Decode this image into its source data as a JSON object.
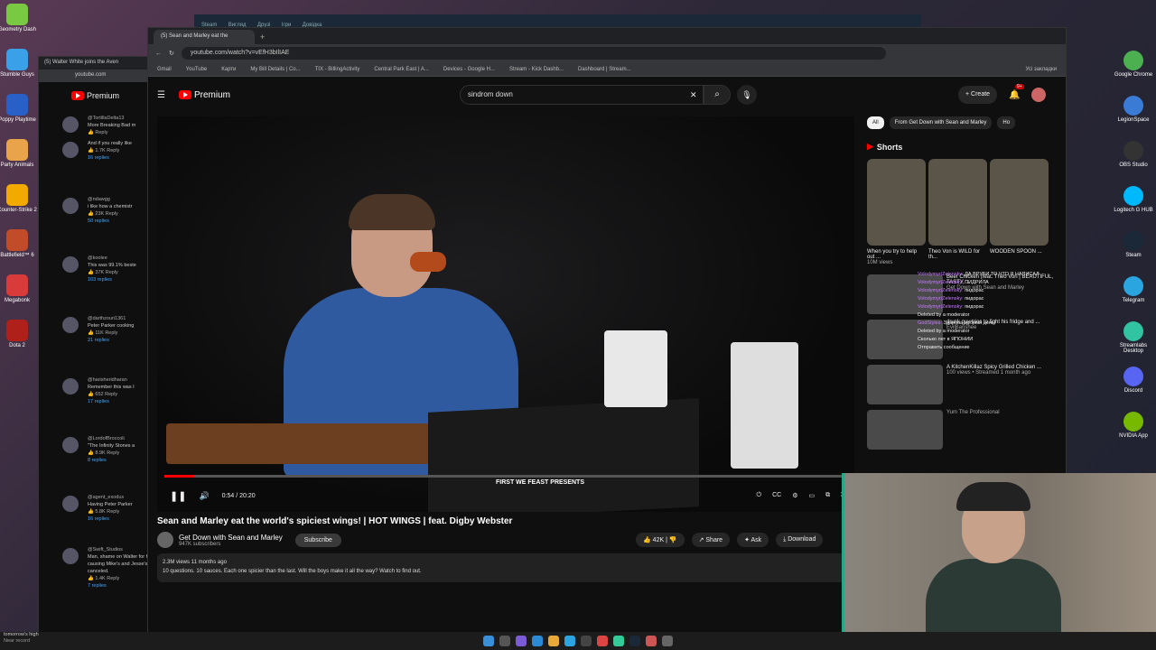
{
  "desktop_left": [
    {
      "label": "Geometry Dash",
      "color": "#7ac943"
    },
    {
      "label": "Stumble Guys",
      "color": "#3aa0e8"
    },
    {
      "label": "Poppy Playtime",
      "color": "#2960c8"
    },
    {
      "label": "Party Animals",
      "color": "#e9a34a"
    },
    {
      "label": "Counter-Strike 2",
      "color": "#f2a900"
    },
    {
      "label": "Battlefield™ 6",
      "color": "#c24b2a"
    },
    {
      "label": "Megabonk",
      "color": "#d93a3a"
    },
    {
      "label": "Dota 2",
      "color": "#b0201b"
    }
  ],
  "desktop_right": [
    {
      "label": "Google Chrome",
      "color": "#4caf50"
    },
    {
      "label": "LegionSpace",
      "color": "#3a7bd5"
    },
    {
      "label": "OBS Studio",
      "color": "#333"
    },
    {
      "label": "Logitech G HUB",
      "color": "#00b8fc"
    },
    {
      "label": "Steam",
      "color": "#1b2838"
    },
    {
      "label": "Telegram",
      "color": "#2aa5e0"
    },
    {
      "label": "Streamlabs Desktop",
      "color": "#31c3a2"
    },
    {
      "label": "Discord",
      "color": "#5865f2"
    },
    {
      "label": "NVIDIA App",
      "color": "#76b900"
    }
  ],
  "steam_bar": {
    "items": [
      "Steam",
      "Вигляд",
      "Друзі",
      "Ігри",
      "Довідка"
    ]
  },
  "browser": {
    "tab_title": "(5) Sean and Marley eat the",
    "back_tab_title": "(5) Walter White joins the Aven",
    "url": "youtube.com/watch?v=vEfH3bIlIAE",
    "back_url": "youtube.com",
    "bookmarks": [
      "Gmail",
      "YouTube",
      "Карти",
      "My Bill Details | Co...",
      "TIX - BillingActivity",
      "Central Park East | A...",
      "Devices - Google H...",
      "Stream - Kick Dashb...",
      "Dashboard | Stream..."
    ],
    "all_bookmarks": "Усі закладки"
  },
  "youtube": {
    "logo_text": "Premium",
    "search_value": "sindrom down",
    "create": "Create",
    "notif_count": "9+"
  },
  "player": {
    "time": "0:54 / 20:20",
    "progress": 0.044,
    "overlay_text": "FIRST WE FEAST PRESENTS"
  },
  "video": {
    "title": "Sean and Marley eat the world's spiciest wings! | HOT WINGS | feat. Digby Webster",
    "channel": "Get Down with Sean and Marley",
    "subscribers": "947K subscribers",
    "subscribe": "Subscribe",
    "likes": "42K",
    "share": "Share",
    "ask": "Ask",
    "download": "Download",
    "meta": "2.3M views  11 months ago",
    "description": "10 questions. 10 sauces. Each one spicier than the last. Will the boys make it all the way? Watch to find out."
  },
  "comments": [
    {
      "author": "@TortillaDelta13",
      "text": "More Breaking Bad m",
      "likes": "",
      "replies": ""
    },
    {
      "author": "",
      "text": "And if you really like",
      "likes": "1.7K",
      "replies": "16 replies"
    },
    {
      "author": "@ndawgg",
      "text": "i like how a chemistr",
      "likes": "23K",
      "replies": "50 replies"
    },
    {
      "author": "@koolee",
      "text": "This was 99.1% beste",
      "likes": "37K",
      "replies": "103 replies"
    },
    {
      "author": "@darthzouri1361",
      "text": "Peter Parker cooking",
      "likes": "11K",
      "replies": "21 replies"
    },
    {
      "author": "@harisheridharan",
      "text": "Remember this was I",
      "likes": "652",
      "replies": "17 replies"
    },
    {
      "author": "@LordofBroccoli",
      "text": "\"The Infinity Stones a",
      "likes": "8.9K",
      "replies": "8 replies"
    },
    {
      "author": "@agent_exodus",
      "text": "Having Peter Parker",
      "likes": "5.8K",
      "replies": "16 replies"
    },
    {
      "author": "@Swift_Studios",
      "text": "Man, shame on Walter for his drug war causing Mike's and Jesse's flight to be canceled.",
      "likes": "1.4K",
      "replies": "7 replies"
    }
  ],
  "reply_label": "Reply",
  "sidebar": {
    "chips": [
      "All",
      "From Get Down with Sean and Marley",
      "Ho"
    ],
    "shorts_title": "Shorts",
    "shorts": [
      {
        "title": "When you try to help out ...",
        "views": "10M views"
      },
      {
        "title": "Theo Von is WILD for th...",
        "views": ""
      },
      {
        "title": "WOODEN SPOON ...",
        "views": ""
      }
    ],
    "recs": [
      {
        "title": "Beer Chicken (feat. Theo Von | BEAUTIFUL, TASTY, ...",
        "channel": "Get Down with Sean and Marley"
      },
      {
        "title": "drunk guy tries to fight his fridge and ...",
        "channel": "EvilBanshee"
      },
      {
        "title": "A KitchenKillaz Spicy Grilled Chicken ...",
        "channel": "100 views • Streamed 1 month ago"
      },
      {
        "title": "",
        "channel": "Yum The Professional"
      }
    ]
  },
  "chat": [
    {
      "user": "Volodymyr|Zelensky:",
      "msg": "ДА ВРУБИ ТО ЧТО Я НАПИСАЛ"
    },
    {
      "user": "Volodymyr|Zelensky:",
      "msg": "ПИДРИЛА"
    },
    {
      "user": "Volodymyr|Zelensky:",
      "msg": "пидорас"
    },
    {
      "user": "Volodymyr|Zelensky:",
      "msg": "пидорас"
    },
    {
      "user": "Volodymyr|Zelensky:",
      "msg": "пидорас"
    },
    {
      "user": "",
      "msg": "Deleted by a moderator"
    },
    {
      "user": "GodStyles:",
      "msg": "Здарова добрый день!"
    },
    {
      "user": "",
      "msg": "Deleted by a moderator"
    },
    {
      "user": "",
      "msg": "Сколько лет в ЯПОНИИ"
    },
    {
      "user": "",
      "msg": "Отправить сообщение"
    }
  ],
  "taskbar_note": {
    "line1": "tomorrow's high",
    "line2": "Near record"
  }
}
